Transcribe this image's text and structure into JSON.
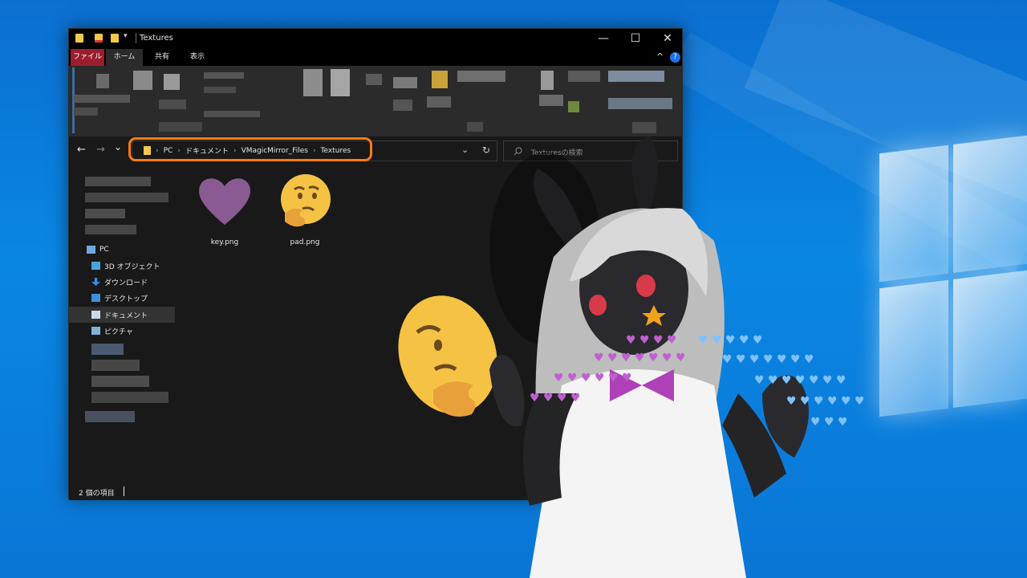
{
  "window": {
    "title": "Textures",
    "minimize_glyph": "—",
    "maximize_glyph": "☐",
    "close_glyph": "✕"
  },
  "ribbon": {
    "tabs": [
      "ファイル",
      "ホーム",
      "共有",
      "表示"
    ],
    "collapse_glyph": "^",
    "help_glyph": "?"
  },
  "navigation": {
    "back_glyph": "←",
    "forward_glyph": "→",
    "recent_glyph": "⌄",
    "up_glyph": "↑",
    "dropdown_glyph": "⌄",
    "refresh_glyph": "↻"
  },
  "address": {
    "crumbs": [
      "PC",
      "ドキュメント",
      "VMagicMirror_Files",
      "Textures"
    ],
    "separator": "›",
    "highlight_color": "#ff7a10"
  },
  "search": {
    "placeholder": "Texturesの検索",
    "icon": "search-icon"
  },
  "nav_pane": {
    "items": [
      {
        "label": "PC",
        "icon": "pc-icon"
      },
      {
        "label": "3D オブジェクト",
        "icon": "cube-icon"
      },
      {
        "label": "ダウンロード",
        "icon": "download-icon"
      },
      {
        "label": "デスクトップ",
        "icon": "desktop-icon"
      },
      {
        "label": "ドキュメント",
        "icon": "document-icon"
      },
      {
        "label": "ピクチャ",
        "icon": "picture-icon"
      }
    ]
  },
  "files": [
    {
      "name": "key.png",
      "icon": "purple-heart-icon"
    },
    {
      "name": "pad.png",
      "icon": "thinking-face-icon"
    }
  ],
  "status": {
    "item_count": "2 個の項目"
  },
  "colors": {
    "file_tab": "#9c1d2e",
    "heart": "#8a5a93",
    "emoji": "#f6c243",
    "desktop_blue": "#0a86e3"
  }
}
